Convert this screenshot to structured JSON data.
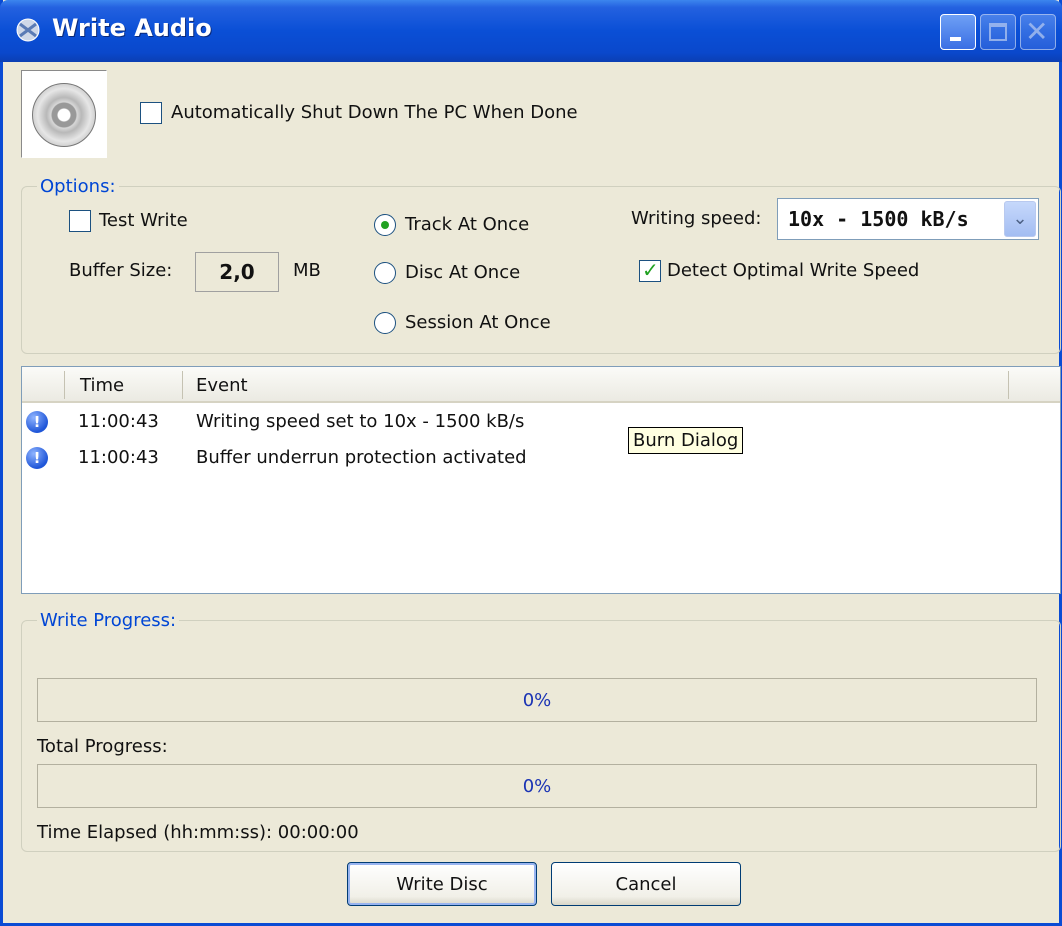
{
  "window": {
    "title": "Write Audio"
  },
  "top": {
    "shutdown_label": "Automatically Shut Down The PC When Done",
    "shutdown_checked": false
  },
  "options": {
    "group_label": "Options:",
    "test_write_label": "Test Write",
    "buffer_label": "Buffer Size:",
    "buffer_value": "2,0",
    "buffer_unit": "MB",
    "modes": [
      {
        "label": "Track At Once",
        "selected": true
      },
      {
        "label": "Disc At Once",
        "selected": false
      },
      {
        "label": "Session At Once",
        "selected": false
      }
    ],
    "speed_label": "Writing speed:",
    "speed_value": "10x - 1500 kB/s",
    "detect_label": "Detect Optimal Write Speed",
    "detect_checked": true
  },
  "log": {
    "columns": [
      "Time",
      "Event"
    ],
    "rows": [
      {
        "time": "11:00:43",
        "event": "Writing speed set to 10x - 1500 kB/s",
        "icon": "info-icon"
      },
      {
        "time": "11:00:43",
        "event": "Buffer underrun protection activated",
        "icon": "info-icon"
      }
    ],
    "tooltip": "Burn Dialog"
  },
  "progress": {
    "group_label": "Write Progress:",
    "write_percent_text": "0%",
    "write_fraction": 0,
    "total_label": "Total Progress:",
    "total_percent_text": "0%",
    "total_fraction": 0,
    "elapsed": "Time Elapsed (hh:mm:ss): 00:00:00"
  },
  "buttons": {
    "write": "Write Disc",
    "cancel": "Cancel"
  },
  "colors": {
    "title_bar": "#0a4fd6",
    "group_label": "#0046d5",
    "progress_text": "#1a33b4"
  }
}
